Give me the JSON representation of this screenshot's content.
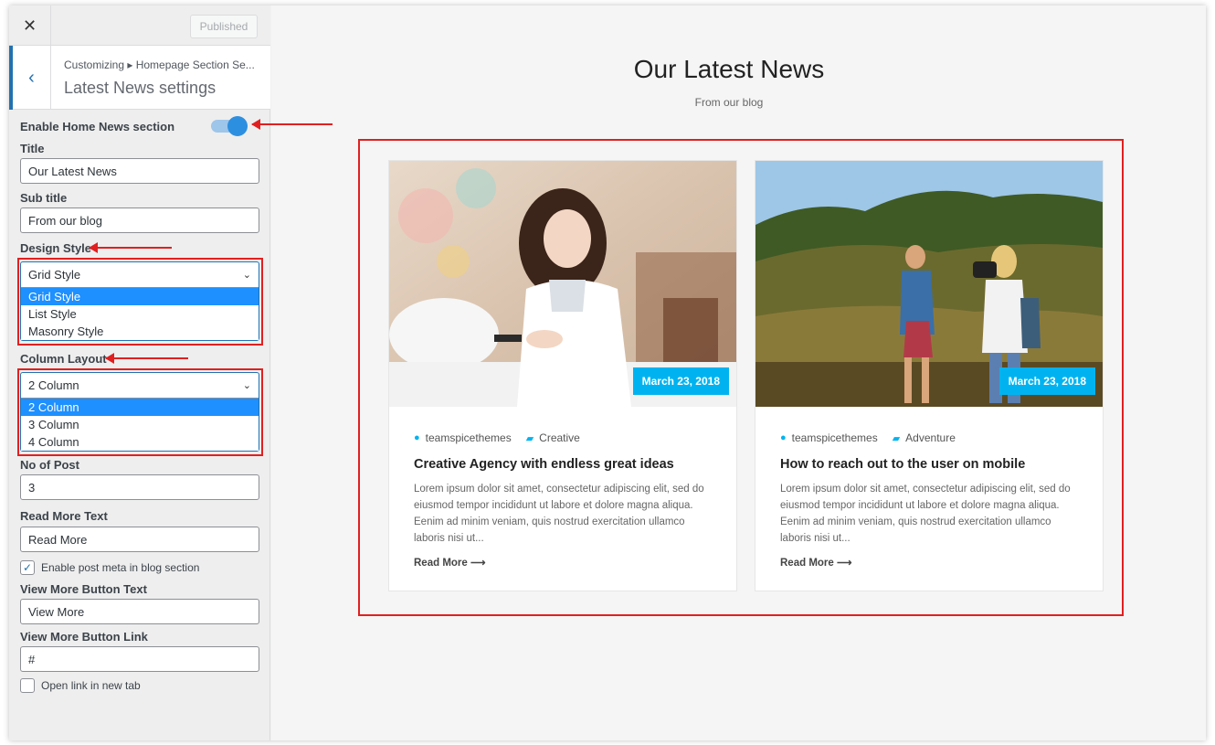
{
  "topbar": {
    "close_glyph": "✕",
    "publish_label": "Published"
  },
  "section": {
    "back_glyph": "‹",
    "breadcrumb": "Customizing ▸ Homepage Section Se...",
    "title": "Latest News settings"
  },
  "controls": {
    "enable_label": "Enable Home News section",
    "enable_on": true,
    "title_label": "Title",
    "title_value": "Our Latest News",
    "subtitle_label": "Sub title",
    "subtitle_value": "From our blog",
    "design_label": "Design Style",
    "design_selected": "Grid Style",
    "design_options": [
      "Grid Style",
      "List Style",
      "Masonry Style"
    ],
    "column_label": "Column Layout",
    "column_selected": "2 Column",
    "column_options": [
      "2 Column",
      "3 Column",
      "4 Column"
    ],
    "posts_label": "No of Post",
    "posts_value": "3",
    "readmore_label": "Read More Text",
    "readmore_value": "Read More",
    "meta_label": "Enable post meta in blog section",
    "meta_checked": true,
    "viewmore_label": "View More Button Text",
    "viewmore_value": "View More",
    "viewlink_label": "View More Button Link",
    "viewlink_value": "#",
    "newtab_label": "Open link in new tab",
    "newtab_checked": false,
    "chevron_glyph": "⌄",
    "check_glyph": "✓"
  },
  "preview": {
    "heading": "Our Latest News",
    "subheading": "From our blog",
    "posts": [
      {
        "date": "March 23, 2018",
        "author": "teamspicethemes",
        "category": "Creative",
        "title": "Creative Agency with endless great ideas",
        "excerpt": "Lorem ipsum dolor sit amet, consectetur adipiscing elit, sed do eiusmod tempor incididunt ut labore et dolore magna aliqua. Eenim ad minim veniam, quis nostrud exercitation ullamco laboris nisi ut...",
        "read_more": "Read More ⟶"
      },
      {
        "date": "March 23, 2018",
        "author": "teamspicethemes",
        "category": "Adventure",
        "title": "How to reach out to the user on mobile",
        "excerpt": "Lorem ipsum dolor sit amet, consectetur adipiscing elit, sed do eiusmod tempor incididunt ut labore et dolore magna aliqua. Eenim ad minim veniam, quis nostrud exercitation ullamco laboris nisi ut...",
        "read_more": "Read More ⟶"
      }
    ]
  },
  "colors": {
    "accent": "#2271b1",
    "badge": "#00b3f0",
    "highlight": "#e02020",
    "selected_option": "#1e90ff"
  }
}
